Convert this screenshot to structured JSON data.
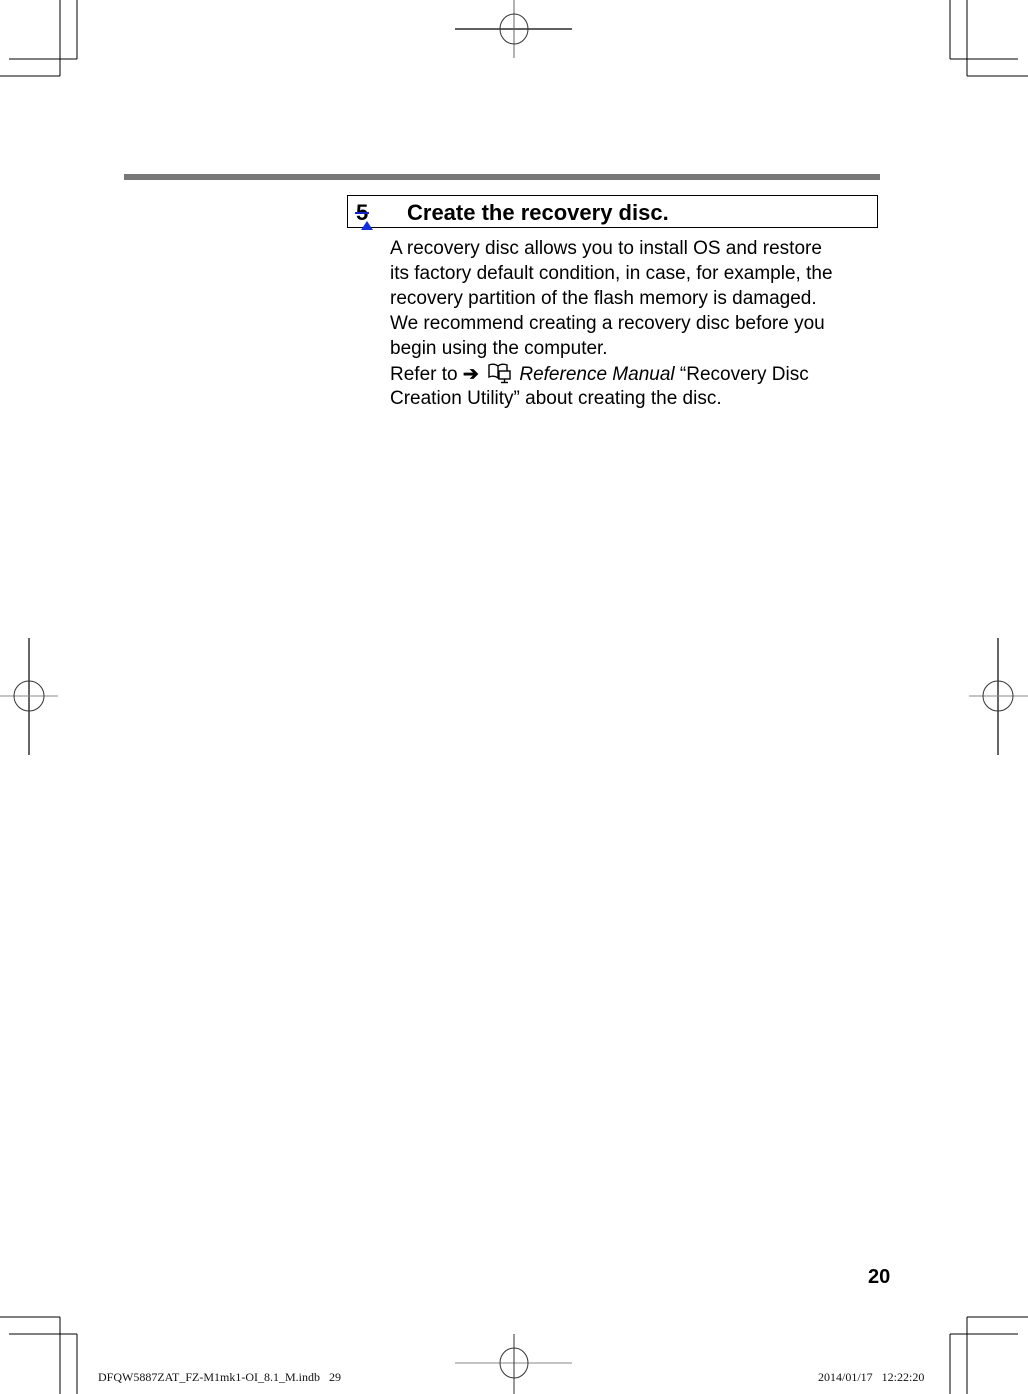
{
  "step": {
    "number": "5",
    "title": "Create the recovery disc."
  },
  "body": {
    "lines": [
      "A recovery disc allows you to install OS and restore",
      "its factory default condition, in case, for example, the",
      "recovery partition of the flash memory is damaged.",
      "We recommend creating a recovery disc before you",
      "begin using the computer."
    ]
  },
  "reference": {
    "prefix": "Refer to",
    "arrow": "➔",
    "icon": "reference-manual-book-icon",
    "manual": "Reference Manual",
    "quote": "“Recovery Disc",
    "line2": "Creation Utility” about creating the disc."
  },
  "page_number": "20",
  "footer": {
    "file": "DFQW5887ZAT_FZ-M1mk1-OI_8.1_M.indb   29",
    "timestamp": "2014/01/17   12:22:20"
  }
}
